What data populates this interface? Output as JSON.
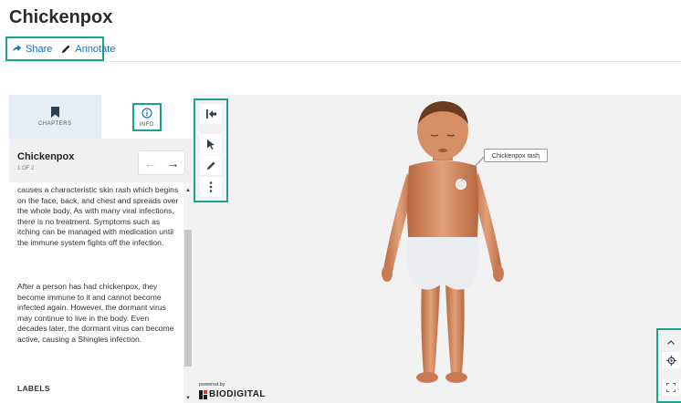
{
  "page": {
    "title": "Chickenpox"
  },
  "actions": {
    "share": "Share",
    "annotate": "Annotate"
  },
  "panel": {
    "tabs": [
      {
        "label": "CHAPTERS",
        "icon": "bookmark-icon"
      },
      {
        "label": "INFO",
        "icon": "info-icon"
      }
    ],
    "chapter_title": "Chickenpox",
    "chapter_count": "1 OF 2",
    "nav": {
      "prev": "←",
      "next": "→"
    },
    "paragraphs": [
      "causes a characteristic skin rash which begins on the face, back, and chest and spreads over the whole body. As with many viral infections, there is no treatment. Symptoms such as itching can be managed with medication until the immune system fights off the infection.",
      "After a person has had chickenpox, they become immune to it and cannot become infected again. However, the dormant virus may continue to live in the body. Even decades later, the dormant virus can become active, causing a Shingles infection."
    ],
    "labels_heading": "LABELS"
  },
  "viewer": {
    "callout": "Chickenpox rash",
    "powered_by": "powered by",
    "brand": "BIODIGITAL",
    "colors": {
      "highlight": "#1aa58a",
      "link": "#1a6fb5",
      "skin": "#d9926a"
    }
  }
}
